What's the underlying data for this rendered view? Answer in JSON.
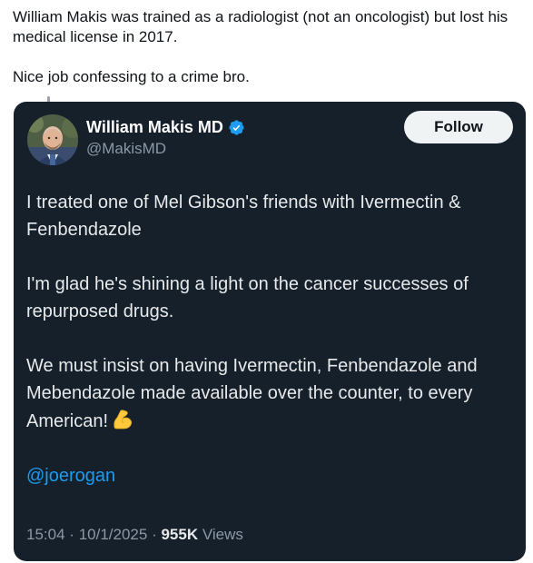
{
  "outer_post": {
    "line1": "William Makis was trained as a radiologist (not an oncologist) but lost his",
    "line2": "medical license in 2017.",
    "line3": "Nice job confessing to a crime bro."
  },
  "quoted_tweet": {
    "author_name": "William Makis MD",
    "author_handle": "@MakisMD",
    "verified_icon": "verified-badge-icon",
    "follow_label": "Follow",
    "body": {
      "p1_line1": "I treated one of Mel Gibson's friends with Ivermectin &",
      "p1_line2": "Fenbendazole",
      "p2_line1": "I'm glad he's shining a light on the cancer successes of",
      "p2_line2": "repurposed drugs.",
      "p3_line1": "We must insist on having Ivermectin, Fenbendazole and",
      "p3_line2": "Mebendazole made available over the counter, to every",
      "p3_line3": "American!",
      "emoji": "flexed-biceps-icon",
      "mention": "@joerogan"
    },
    "meta": {
      "time": "15:04",
      "sep1": "·",
      "date": "10/1/2025",
      "sep2": "·",
      "views_count": "955K",
      "views_label": "Views"
    }
  },
  "colors": {
    "card_background": "#15202b",
    "mention_blue": "#1d9bf0",
    "verified_blue": "#1d9bf0",
    "muted_text": "#8b98a5"
  }
}
